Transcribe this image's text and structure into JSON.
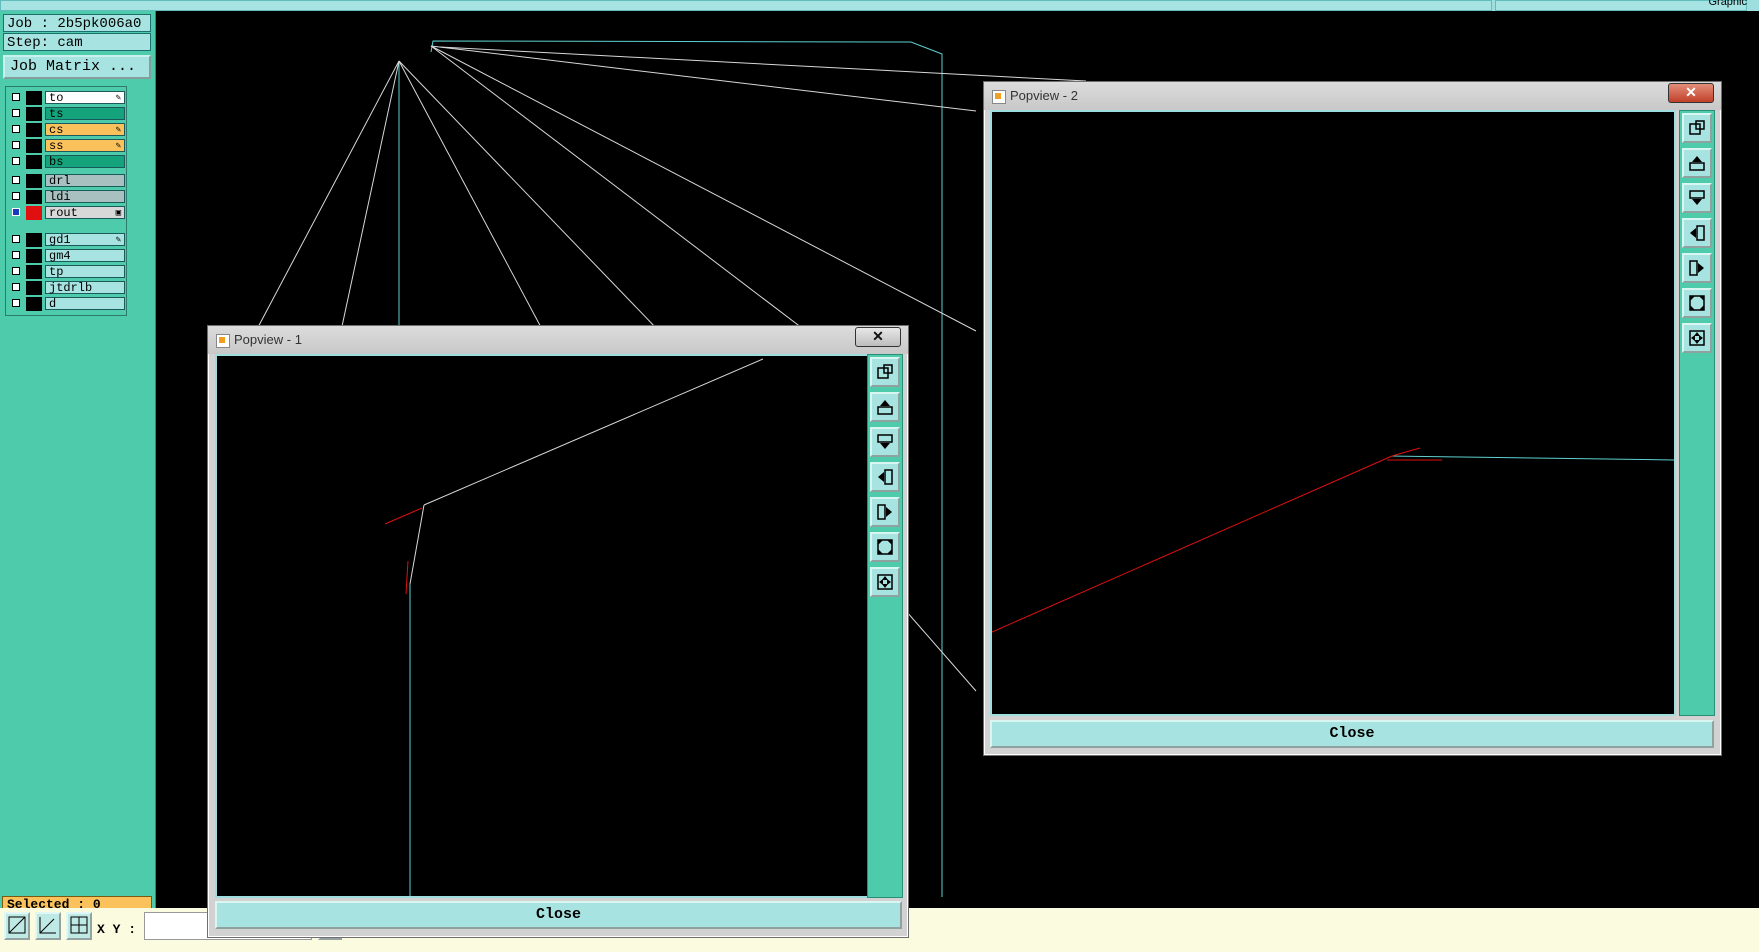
{
  "top_right_label": "Graphic",
  "job_label": "Job : 2b5pk006a0",
  "step_label": "Step: cam",
  "job_matrix_button": "Job Matrix ...",
  "layer_groups": [
    [
      {
        "name": "to",
        "color": "#ffffff",
        "marker": "✎"
      },
      {
        "name": "ts",
        "color": "#14a37a",
        "marker": ""
      },
      {
        "name": "cs",
        "color": "#fbc25c",
        "marker": "✎"
      },
      {
        "name": "ss",
        "color": "#fbc25c",
        "marker": "✎"
      },
      {
        "name": "bs",
        "color": "#14a37a",
        "marker": ""
      }
    ],
    [
      {
        "name": "drl",
        "color": "#a8c0c0",
        "marker": ""
      },
      {
        "name": "ldi",
        "color": "#a8c0c0",
        "marker": ""
      },
      {
        "name": "rout",
        "color": "#d8d8d8",
        "marker": "▣",
        "selected": true,
        "swatch": "#e01010"
      }
    ],
    [
      {
        "name": "gd1",
        "color": "#a7e3e0",
        "marker": "✎"
      },
      {
        "name": "gm4",
        "color": "#a7e3e0",
        "marker": ""
      },
      {
        "name": "tp",
        "color": "#a7e3e0",
        "marker": ""
      },
      {
        "name": "jtdrlb",
        "color": "#a7e3e0",
        "marker": ""
      },
      {
        "name": "d",
        "color": "#a7e3e0",
        "marker": ""
      }
    ]
  ],
  "selected_label": "Selected : 0",
  "xy_label": "X Y :",
  "xy_value": "",
  "popview1": {
    "title": "Popview - 1",
    "close_label": "Close",
    "close_x": "✕"
  },
  "popview2": {
    "title": "Popview - 2",
    "close_label": "Close",
    "close_x": "✕"
  },
  "toolbar_icons": [
    "zoom-window-icon",
    "pan-up-icon",
    "pan-down-icon",
    "pan-left-icon",
    "pan-right-icon",
    "zoom-fit-icon",
    "zoom-home-icon"
  ],
  "colors": {
    "accent": "#4ecbaa",
    "panel": "#a7e3e0",
    "outline": "#5fd0d0",
    "route": "#e01010",
    "highlight": "#fbc25c"
  }
}
